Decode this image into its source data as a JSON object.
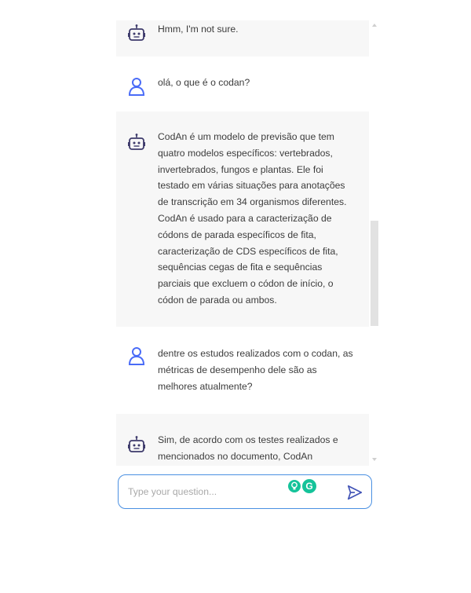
{
  "chat": {
    "messages": [
      {
        "role": "bot",
        "icon": "robot-icon",
        "text": "Hmm, I'm not sure."
      },
      {
        "role": "user",
        "icon": "user-icon",
        "text": "olá, o que é o codan?"
      },
      {
        "role": "bot",
        "icon": "robot-icon",
        "text": "CodAn é um modelo de previsão que tem\nquatro modelos específicos: vertebrados,\ninvertebrados, fungos e plantas. Ele foi\ntestado em várias situações para anotações\nde transcrição em 34 organismos diferentes.\nCodAn é usado para a caracterização de\ncódons de parada específicos de fita,\ncaracterização de CDS específicos de fita,\nsequências cegas de fita e sequências\nparciais que excluem o códon de início, o\ncódon de parada ou ambos."
      },
      {
        "role": "user",
        "icon": "user-icon",
        "text": "dentre os estudos realizados com o codan, as\nmétricas de desempenho dele são as\nmelhores atualmente?"
      },
      {
        "role": "bot",
        "icon": "robot-icon",
        "text": "Sim, de acordo com os testes realizados e\nmencionados no documento, CodAn"
      }
    ]
  },
  "input": {
    "placeholder": "Type your question...",
    "value": "",
    "extension_badge": "G"
  },
  "colors": {
    "bot_bubble": "#f7f7f7",
    "user_icon": "#4a6cf7",
    "robot_icon": "#3d3a6b",
    "input_border": "#4a90e2",
    "send_icon": "#3f51b5",
    "grammarly": "#15c39a"
  }
}
